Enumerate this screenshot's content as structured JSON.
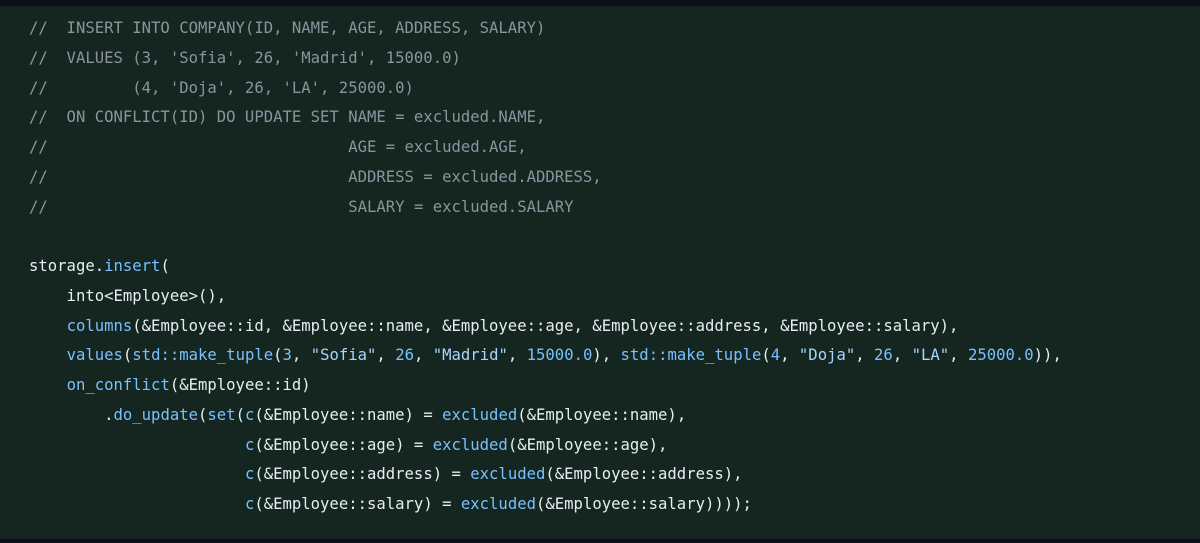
{
  "code_block": {
    "language": "cpp",
    "lines": [
      [
        {
          "t": "c",
          "v": "//  INSERT INTO COMPANY(ID, NAME, AGE, ADDRESS, SALARY)"
        }
      ],
      [
        {
          "t": "c",
          "v": "//  VALUES (3, 'Sofia', 26, 'Madrid', 15000.0)"
        }
      ],
      [
        {
          "t": "c",
          "v": "//         (4, 'Doja', 26, 'LA', 25000.0)"
        }
      ],
      [
        {
          "t": "c",
          "v": "//  ON CONFLICT(ID) DO UPDATE SET NAME = excluded.NAME,"
        }
      ],
      [
        {
          "t": "c",
          "v": "//                                AGE = excluded.AGE,"
        }
      ],
      [
        {
          "t": "c",
          "v": "//                                ADDRESS = excluded.ADDRESS,"
        }
      ],
      [
        {
          "t": "c",
          "v": "//                                SALARY = excluded.SALARY"
        }
      ],
      [],
      [
        {
          "t": "p",
          "v": "storage."
        },
        {
          "t": "f",
          "v": "insert"
        },
        {
          "t": "p",
          "v": "("
        }
      ],
      [
        {
          "t": "p",
          "v": "    into<Employee>(),"
        }
      ],
      [
        {
          "t": "p",
          "v": "    "
        },
        {
          "t": "f",
          "v": "columns"
        },
        {
          "t": "p",
          "v": "(&Employee::id, &Employee::name, &Employee::age, &Employee::address, &Employee::salary),"
        }
      ],
      [
        {
          "t": "p",
          "v": "    "
        },
        {
          "t": "f",
          "v": "values"
        },
        {
          "t": "p",
          "v": "("
        },
        {
          "t": "f",
          "v": "std::make_tuple"
        },
        {
          "t": "p",
          "v": "("
        },
        {
          "t": "n",
          "v": "3"
        },
        {
          "t": "p",
          "v": ", "
        },
        {
          "t": "s",
          "v": "\"Sofia\""
        },
        {
          "t": "p",
          "v": ", "
        },
        {
          "t": "n",
          "v": "26"
        },
        {
          "t": "p",
          "v": ", "
        },
        {
          "t": "s",
          "v": "\"Madrid\""
        },
        {
          "t": "p",
          "v": ", "
        },
        {
          "t": "n",
          "v": "15000.0"
        },
        {
          "t": "p",
          "v": "), "
        },
        {
          "t": "f",
          "v": "std::make_tuple"
        },
        {
          "t": "p",
          "v": "("
        },
        {
          "t": "n",
          "v": "4"
        },
        {
          "t": "p",
          "v": ", "
        },
        {
          "t": "s",
          "v": "\"Doja\""
        },
        {
          "t": "p",
          "v": ", "
        },
        {
          "t": "n",
          "v": "26"
        },
        {
          "t": "p",
          "v": ", "
        },
        {
          "t": "s",
          "v": "\"LA\""
        },
        {
          "t": "p",
          "v": ", "
        },
        {
          "t": "n",
          "v": "25000.0"
        },
        {
          "t": "p",
          "v": ")),"
        }
      ],
      [
        {
          "t": "p",
          "v": "    "
        },
        {
          "t": "f",
          "v": "on_conflict"
        },
        {
          "t": "p",
          "v": "(&Employee::id)"
        }
      ],
      [
        {
          "t": "p",
          "v": "        ."
        },
        {
          "t": "f",
          "v": "do_update"
        },
        {
          "t": "p",
          "v": "("
        },
        {
          "t": "f",
          "v": "set"
        },
        {
          "t": "p",
          "v": "("
        },
        {
          "t": "f",
          "v": "c"
        },
        {
          "t": "p",
          "v": "(&Employee::name) = "
        },
        {
          "t": "f",
          "v": "excluded"
        },
        {
          "t": "p",
          "v": "(&Employee::name),"
        }
      ],
      [
        {
          "t": "p",
          "v": "                       "
        },
        {
          "t": "f",
          "v": "c"
        },
        {
          "t": "p",
          "v": "(&Employee::age) = "
        },
        {
          "t": "f",
          "v": "excluded"
        },
        {
          "t": "p",
          "v": "(&Employee::age),"
        }
      ],
      [
        {
          "t": "p",
          "v": "                       "
        },
        {
          "t": "f",
          "v": "c"
        },
        {
          "t": "p",
          "v": "(&Employee::address) = "
        },
        {
          "t": "f",
          "v": "excluded"
        },
        {
          "t": "p",
          "v": "(&Employee::address),"
        }
      ],
      [
        {
          "t": "p",
          "v": "                       "
        },
        {
          "t": "f",
          "v": "c"
        },
        {
          "t": "p",
          "v": "(&Employee::salary) = "
        },
        {
          "t": "f",
          "v": "excluded"
        },
        {
          "t": "p",
          "v": "(&Employee::salary))));"
        }
      ]
    ]
  },
  "colors": {
    "background": "#15251f",
    "comment": "#8b949e",
    "plain": "#e6edf3",
    "function": "#79c0ff",
    "string": "#a5d6ff",
    "number": "#79c0ff"
  }
}
